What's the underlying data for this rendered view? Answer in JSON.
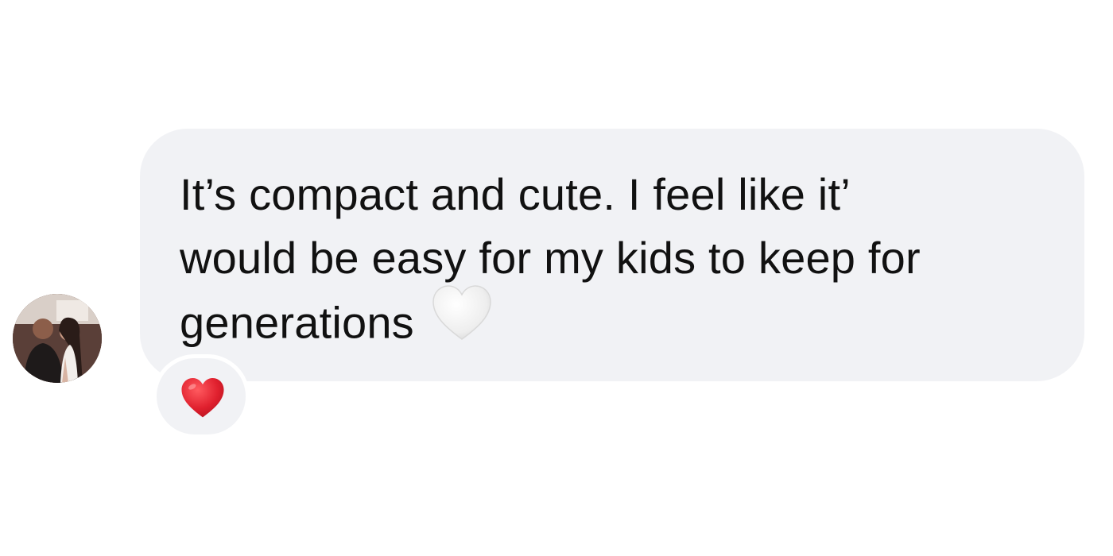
{
  "message": {
    "lines": [
      "It’s compact and cute. I feel like it’",
      "would be easy for my kids to keep for",
      "generations"
    ],
    "trailing_icon": "white-heart-icon"
  },
  "reaction": {
    "icon": "red-heart-icon",
    "color": "#e0202e"
  },
  "sender": {
    "avatar_icon": "avatar-photo"
  },
  "colors": {
    "bubble": "#f1f2f5",
    "text": "#111111",
    "background": "#ffffff"
  }
}
